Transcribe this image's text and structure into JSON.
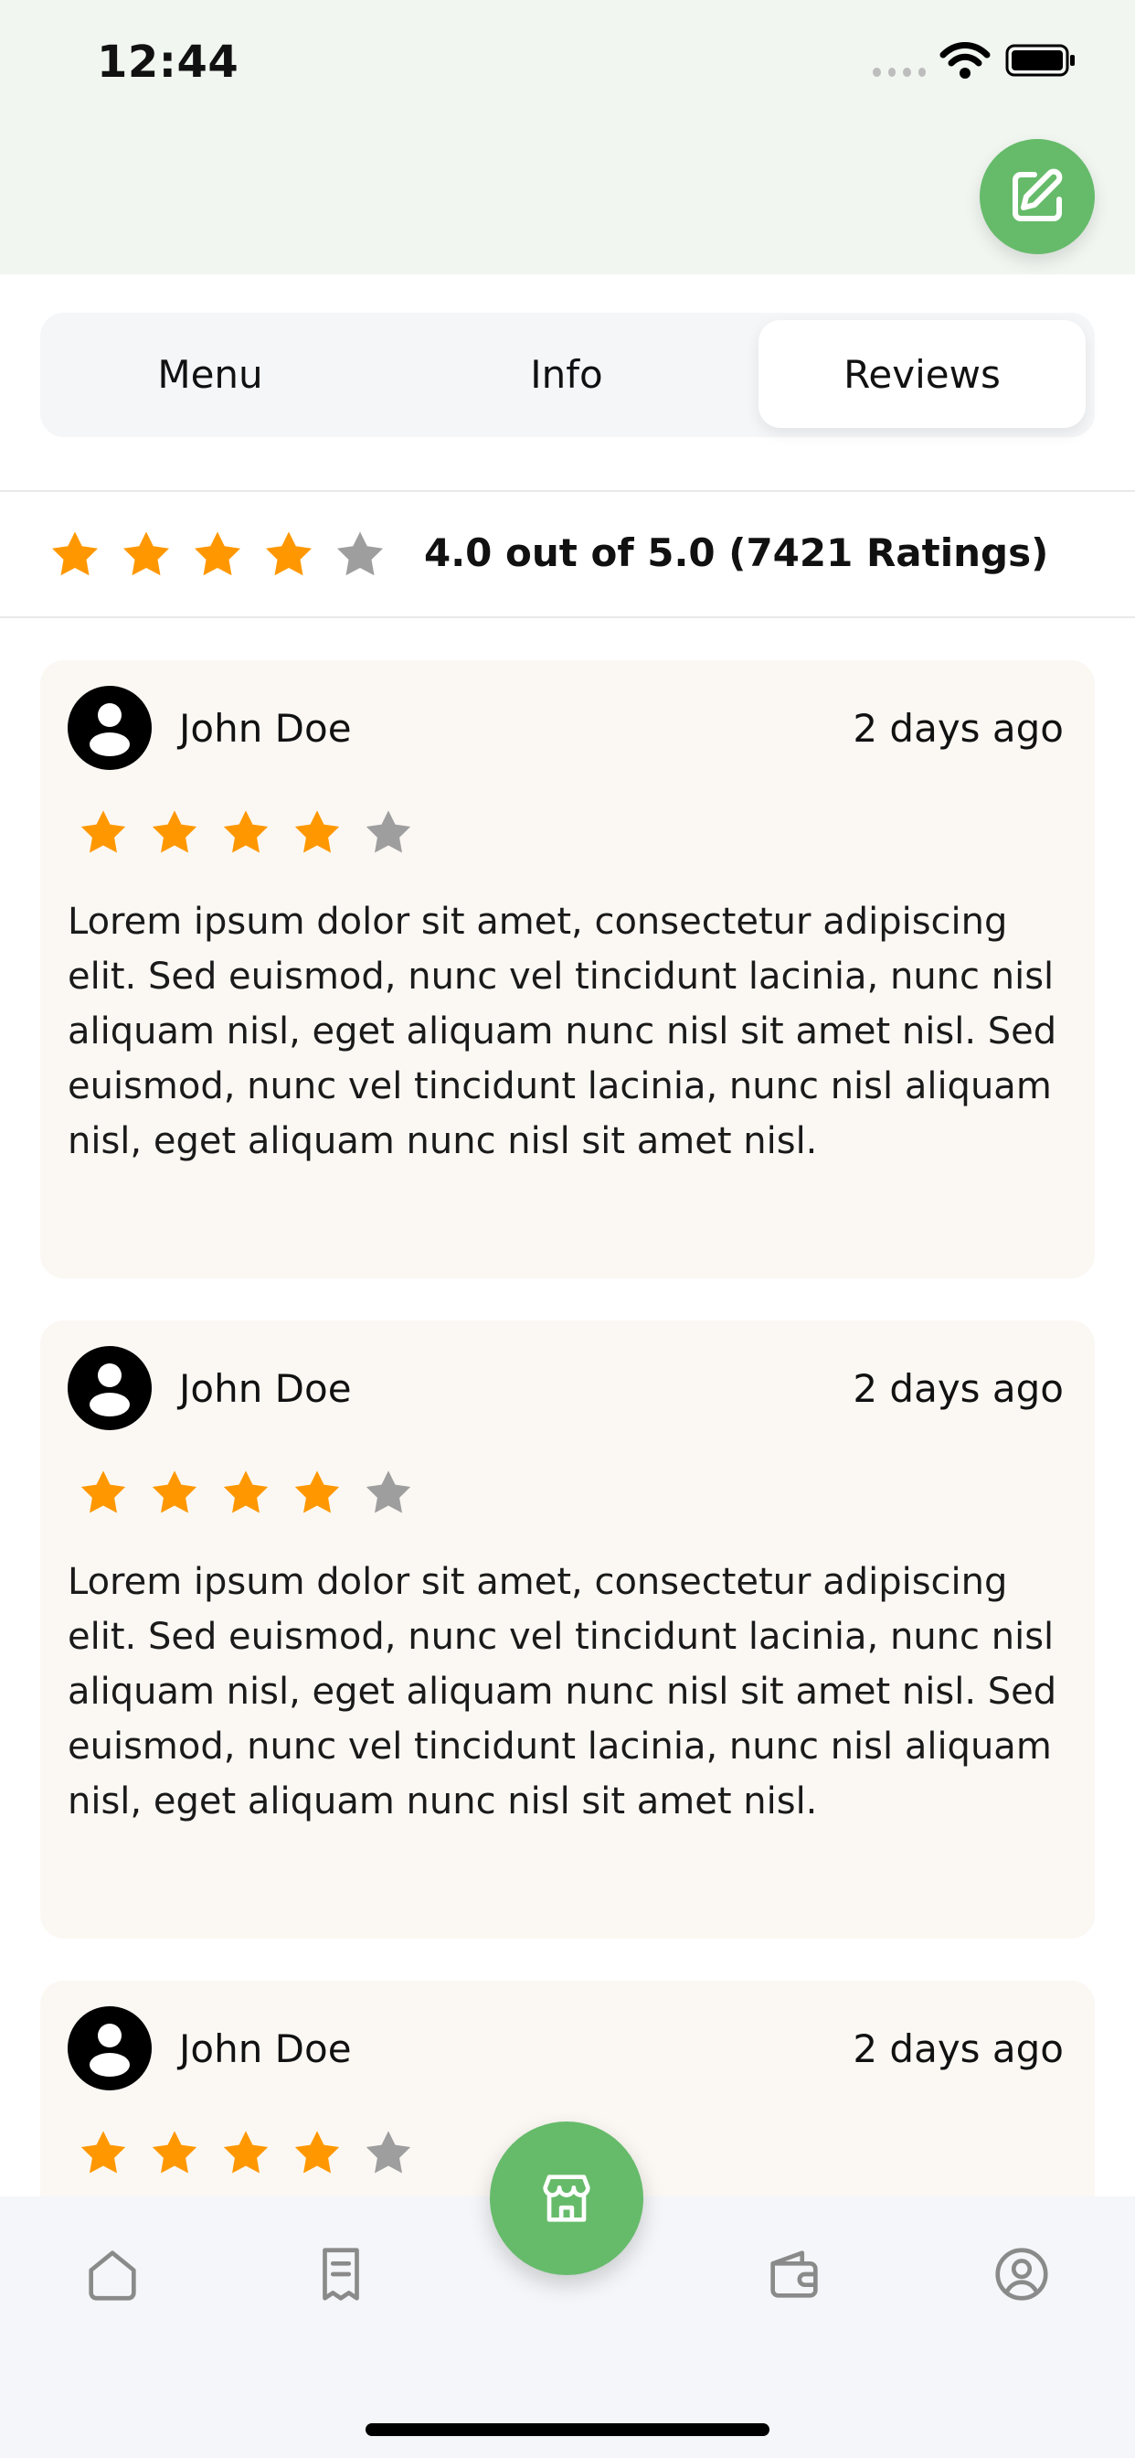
{
  "status_bar": {
    "time": "12:44"
  },
  "tabs": [
    {
      "label": "Menu"
    },
    {
      "label": "Info"
    },
    {
      "label": "Reviews",
      "active": true
    }
  ],
  "summary": {
    "rating": 4,
    "max": 5,
    "text": "4.0 out of 5.0 (7421 Ratings)"
  },
  "reviews": [
    {
      "name": "John Doe",
      "time": "2 days ago",
      "rating": 4,
      "text": "Lorem ipsum dolor sit amet, consectetur adipiscing elit. Sed euismod, nunc vel tincidunt lacinia, nunc nisl aliquam nisl, eget aliquam nunc nisl sit amet nisl. Sed euismod, nunc vel tincidunt lacinia, nunc nisl aliquam nisl, eget aliquam nunc nisl sit amet nisl."
    },
    {
      "name": "John Doe",
      "time": "2 days ago",
      "rating": 4,
      "text": "Lorem ipsum dolor sit amet, consectetur adipiscing elit. Sed euismod, nunc vel tincidunt lacinia, nunc nisl aliquam nisl, eget aliquam nunc nisl sit amet nisl. Sed euismod, nunc vel tincidunt lacinia, nunc nisl aliquam nisl, eget aliquam nunc nisl sit amet nisl."
    },
    {
      "name": "John Doe",
      "time": "2 days ago",
      "rating": 4,
      "text": ""
    }
  ],
  "bottom_nav": {
    "items": [
      "home-icon",
      "receipt-icon",
      "store-icon",
      "wallet-icon",
      "profile-icon"
    ]
  },
  "colors": {
    "accent": "#66bb6a",
    "star_on": "#ff9800",
    "star_off": "#9e9e9e",
    "card_bg": "#fbf8f4",
    "header_bg": "#f1f6f1"
  }
}
